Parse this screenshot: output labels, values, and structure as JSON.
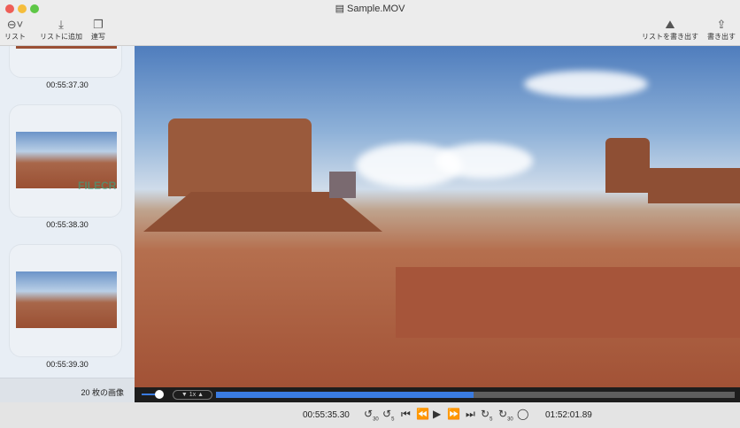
{
  "window": {
    "title": "Sample.MOV"
  },
  "toolbar": {
    "list": "リスト",
    "add_to_list": "リストに追加",
    "copy": "連写",
    "export_list": "リストを書き出す",
    "export": "書き出す"
  },
  "sidebar": {
    "items": [
      {
        "timestamp": "00:55:37.30"
      },
      {
        "timestamp": "00:55:38.30"
      },
      {
        "timestamp": "00:55:39.30"
      }
    ],
    "count": "20 枚の画像"
  },
  "watermark": "FILECR",
  "player": {
    "speed": "1x",
    "progress": 0.496,
    "volume": 0.3,
    "current_time": "00:55:35.30",
    "duration": "01:52:01.89",
    "back30": "30",
    "back5": "5",
    "fwd5": "5",
    "fwd30": "30"
  },
  "colors": {
    "accent": "#3a7be0"
  }
}
